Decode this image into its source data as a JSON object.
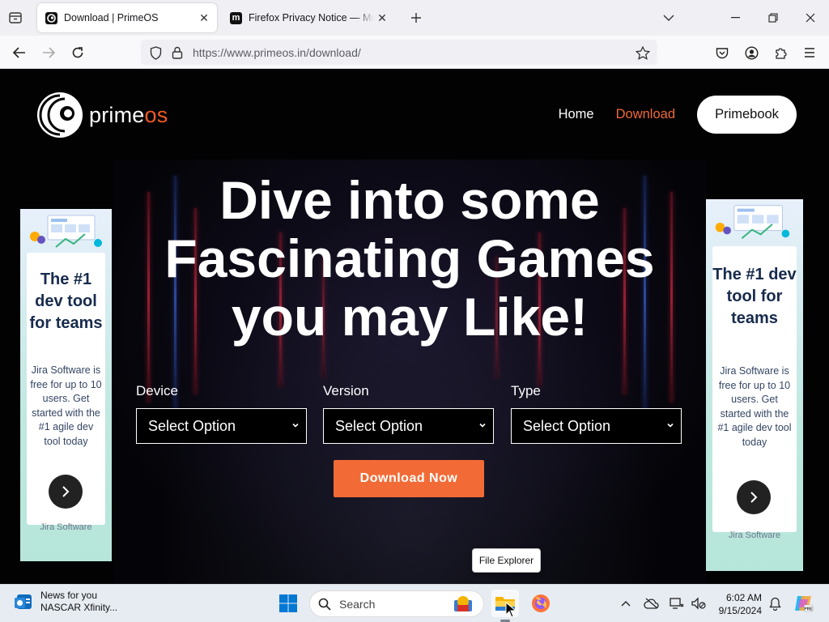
{
  "browser": {
    "tabs": [
      {
        "title": "Download | PrimeOS",
        "active": true
      },
      {
        "title": "Firefox Privacy Notice — Mozilla",
        "active": false
      }
    ],
    "url": "https://www.primeos.in/download/"
  },
  "site": {
    "logo": {
      "part1": "prime",
      "part2": "os"
    },
    "nav": {
      "home": "Home",
      "download": "Download",
      "primebook": "Primebook"
    },
    "headline": "Dive into some Fascinating Games you may Like!",
    "filters": [
      {
        "label": "Device",
        "value": "Select Option"
      },
      {
        "label": "Version",
        "value": "Select Option"
      },
      {
        "label": "Type",
        "value": "Select Option"
      }
    ],
    "download_button": "Download Now",
    "ads": [
      {
        "title": "The #1 dev tool for teams",
        "body": "Jira Software is free for up to 10 users. Get started with the #1 agile dev tool today",
        "brand": "Jira Software"
      },
      {
        "title": "The #1 dev tool for teams",
        "body": "Jira Software is free for up to 10 users. Get started with the #1 agile dev tool today",
        "brand": "Jira Software"
      }
    ],
    "colors": {
      "accent": "#f26b36",
      "background": "#020203"
    }
  },
  "tooltip": "File Explorer",
  "taskbar": {
    "widget": {
      "line1": "News for you",
      "line2": "NASCAR Xfinity..."
    },
    "search_placeholder": "Search",
    "time": "6:02 AM",
    "date": "9/15/2024"
  }
}
